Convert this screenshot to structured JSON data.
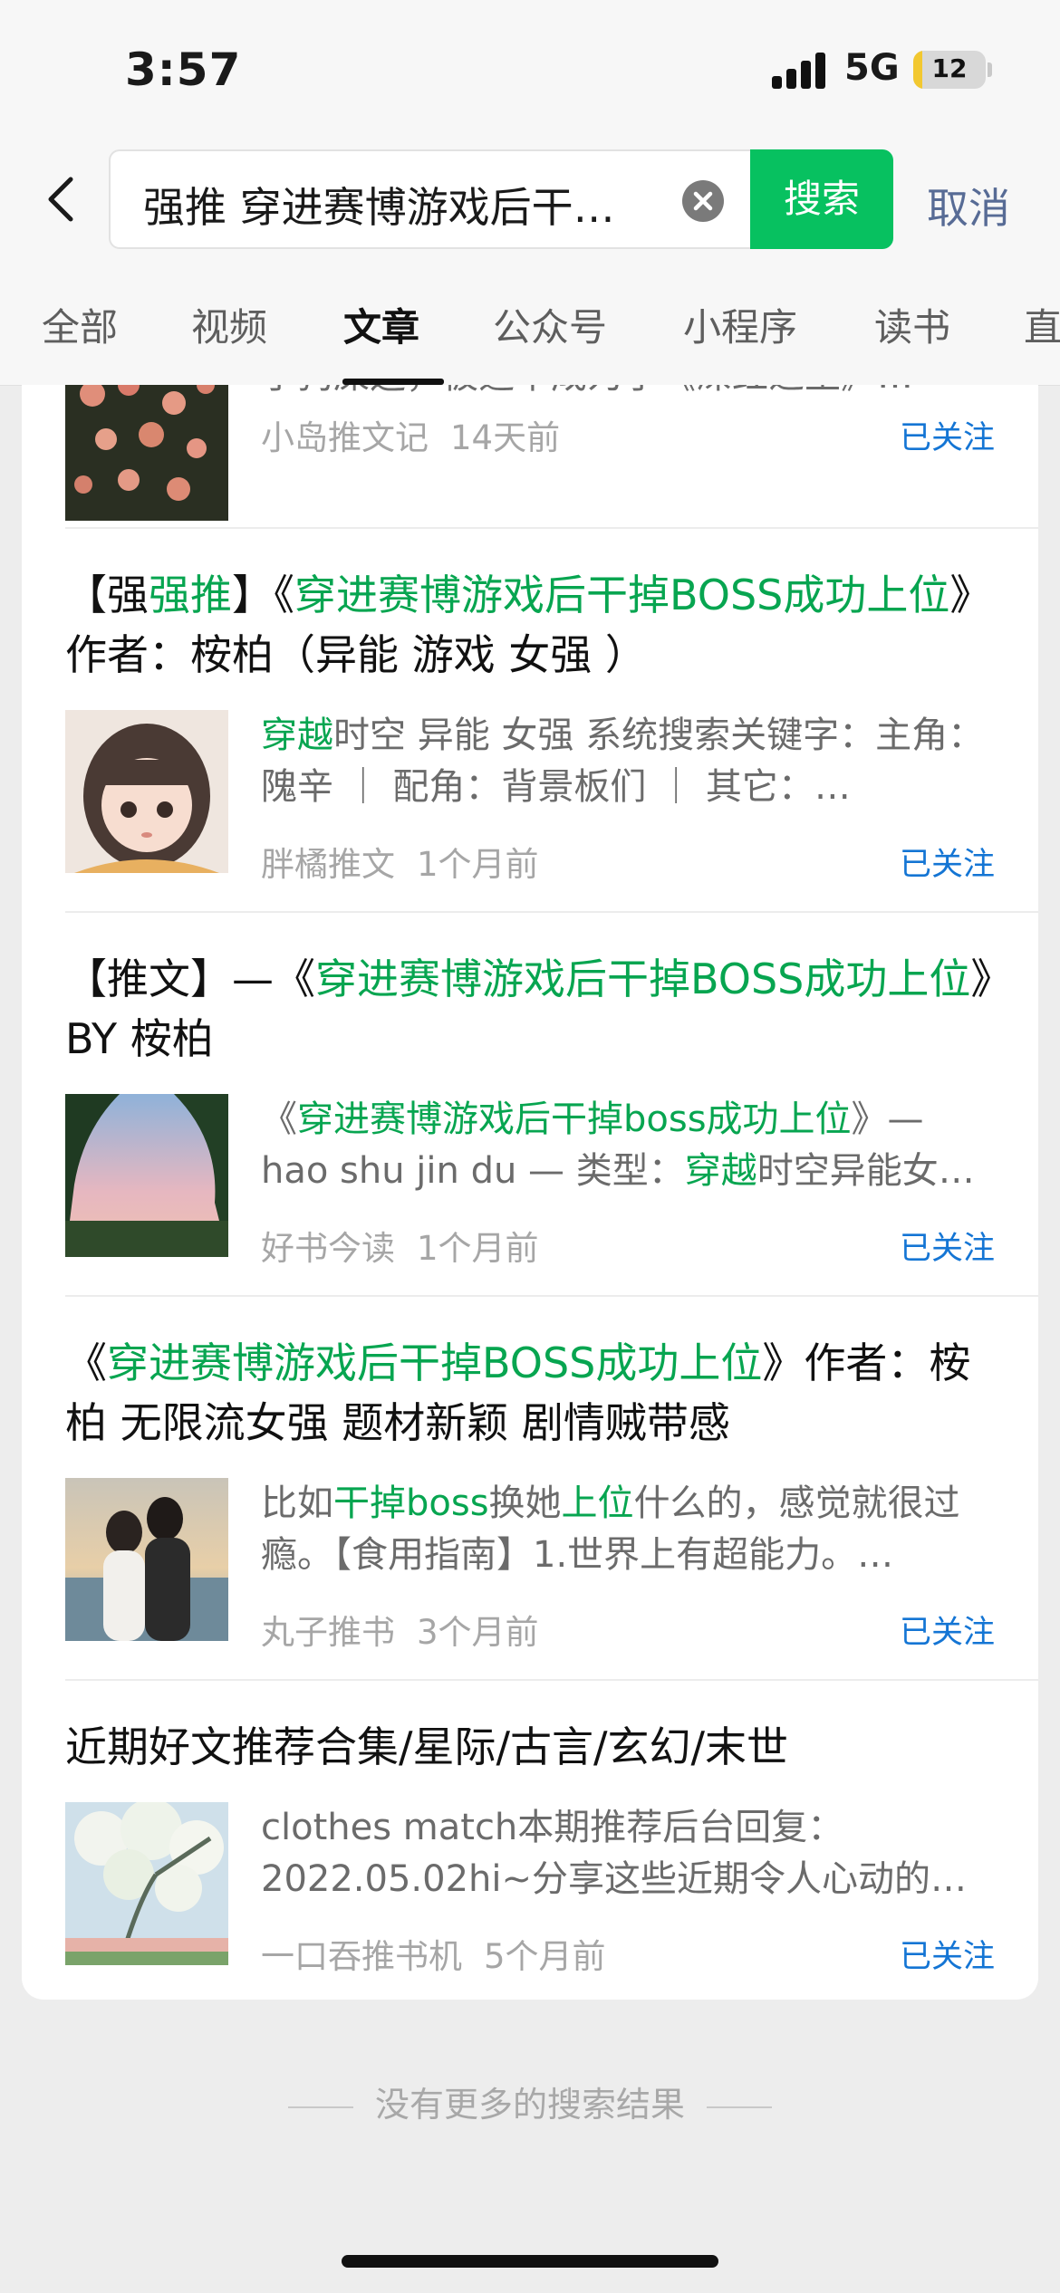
{
  "status_bar": {
    "time": "3:57",
    "network": "5G",
    "battery_level": "12",
    "battery_fraction": 0.12
  },
  "search": {
    "query": "强推 穿进赛博游戏后干…",
    "button_label": "搜索",
    "cancel_label": "取消"
  },
  "tabs": [
    {
      "label": "全部",
      "active": false
    },
    {
      "label": "视频",
      "active": false
    },
    {
      "label": "文章",
      "active": true
    },
    {
      "label": "公众号",
      "active": false
    },
    {
      "label": "小程序",
      "active": false
    },
    {
      "label": "读书",
      "active": false
    },
    {
      "label": "直",
      "active": false
    }
  ],
  "results": [
    {
      "title_parts": [],
      "snippet_parts": [
        {
          "text": "了狗屎运，被选中成为了《深红之王》…",
          "hl": false
        }
      ],
      "author": "小岛推文记",
      "time": "14天前",
      "follow_label": "已关注",
      "thumb_icon": "flowers-photo"
    },
    {
      "title_parts": [
        {
          "text": "【强",
          "hl": false
        },
        {
          "text": "强推",
          "hl": true
        },
        {
          "text": "】《",
          "hl": false
        },
        {
          "text": "穿进赛博游戏后干掉BOSS成功上位",
          "hl": true
        },
        {
          "text": "》作者：桉柏（异能 游戏 女强 ）",
          "hl": false
        }
      ],
      "snippet_parts": [
        {
          "text": "穿越",
          "hl": true
        },
        {
          "text": "时空 异能 女强 系统搜索关键字：主角：隗辛 ｜ 配角：背景板们 ｜ 其它：…",
          "hl": false
        }
      ],
      "author": "胖橘推文",
      "time": "1个月前",
      "follow_label": "已关注",
      "thumb_icon": "anime-girl-avatar"
    },
    {
      "title_parts": [
        {
          "text": "【推文】—《",
          "hl": false
        },
        {
          "text": "穿进赛博游戏后干掉BOSS成功上位",
          "hl": true
        },
        {
          "text": "》BY 桉柏",
          "hl": false
        }
      ],
      "snippet_parts": [
        {
          "text": "《",
          "hl": false
        },
        {
          "text": "穿进赛博游戏后干掉boss成功上位",
          "hl": true
        },
        {
          "text": "》— hao shu jin du — 类型：",
          "hl": false
        },
        {
          "text": "穿越",
          "hl": true
        },
        {
          "text": "时空异能女…",
          "hl": false
        }
      ],
      "author": "好书今读",
      "time": "1个月前",
      "follow_label": "已关注",
      "thumb_icon": "sunset-sky-photo"
    },
    {
      "title_parts": [
        {
          "text": "《",
          "hl": false
        },
        {
          "text": "穿进赛博游戏后干掉BOSS成功上位",
          "hl": true
        },
        {
          "text": "》作者：桉柏 无限流女强 题材新颖 剧情贼带感",
          "hl": false
        }
      ],
      "snippet_parts": [
        {
          "text": "比如",
          "hl": false
        },
        {
          "text": "干掉boss",
          "hl": true
        },
        {
          "text": "换她",
          "hl": false
        },
        {
          "text": "上位",
          "hl": true
        },
        {
          "text": "什么的，感觉就很过瘾。【食用指南】1.世界上有超能力。…",
          "hl": false
        }
      ],
      "author": "丸子推书",
      "time": "3个月前",
      "follow_label": "已关注",
      "thumb_icon": "couple-photo"
    },
    {
      "title_parts": [
        {
          "text": "近期好文推荐合集/星际/古言/玄幻/末世",
          "hl": false
        }
      ],
      "snippet_parts": [
        {
          "text": "clothes match本期推荐后台回复：2022.05.02hi~分享这些近期令人心动的…",
          "hl": false
        }
      ],
      "author": "一口吞推书机",
      "time": "5个月前",
      "follow_label": "已关注",
      "thumb_icon": "blossom-painting"
    }
  ],
  "footer": {
    "no_more_text": "没有更多的搜索结果"
  },
  "colors": {
    "accent_green": "#07c160",
    "highlight_green": "#07a550",
    "link_blue": "#1475d4",
    "cancel_blue": "#576b95"
  }
}
